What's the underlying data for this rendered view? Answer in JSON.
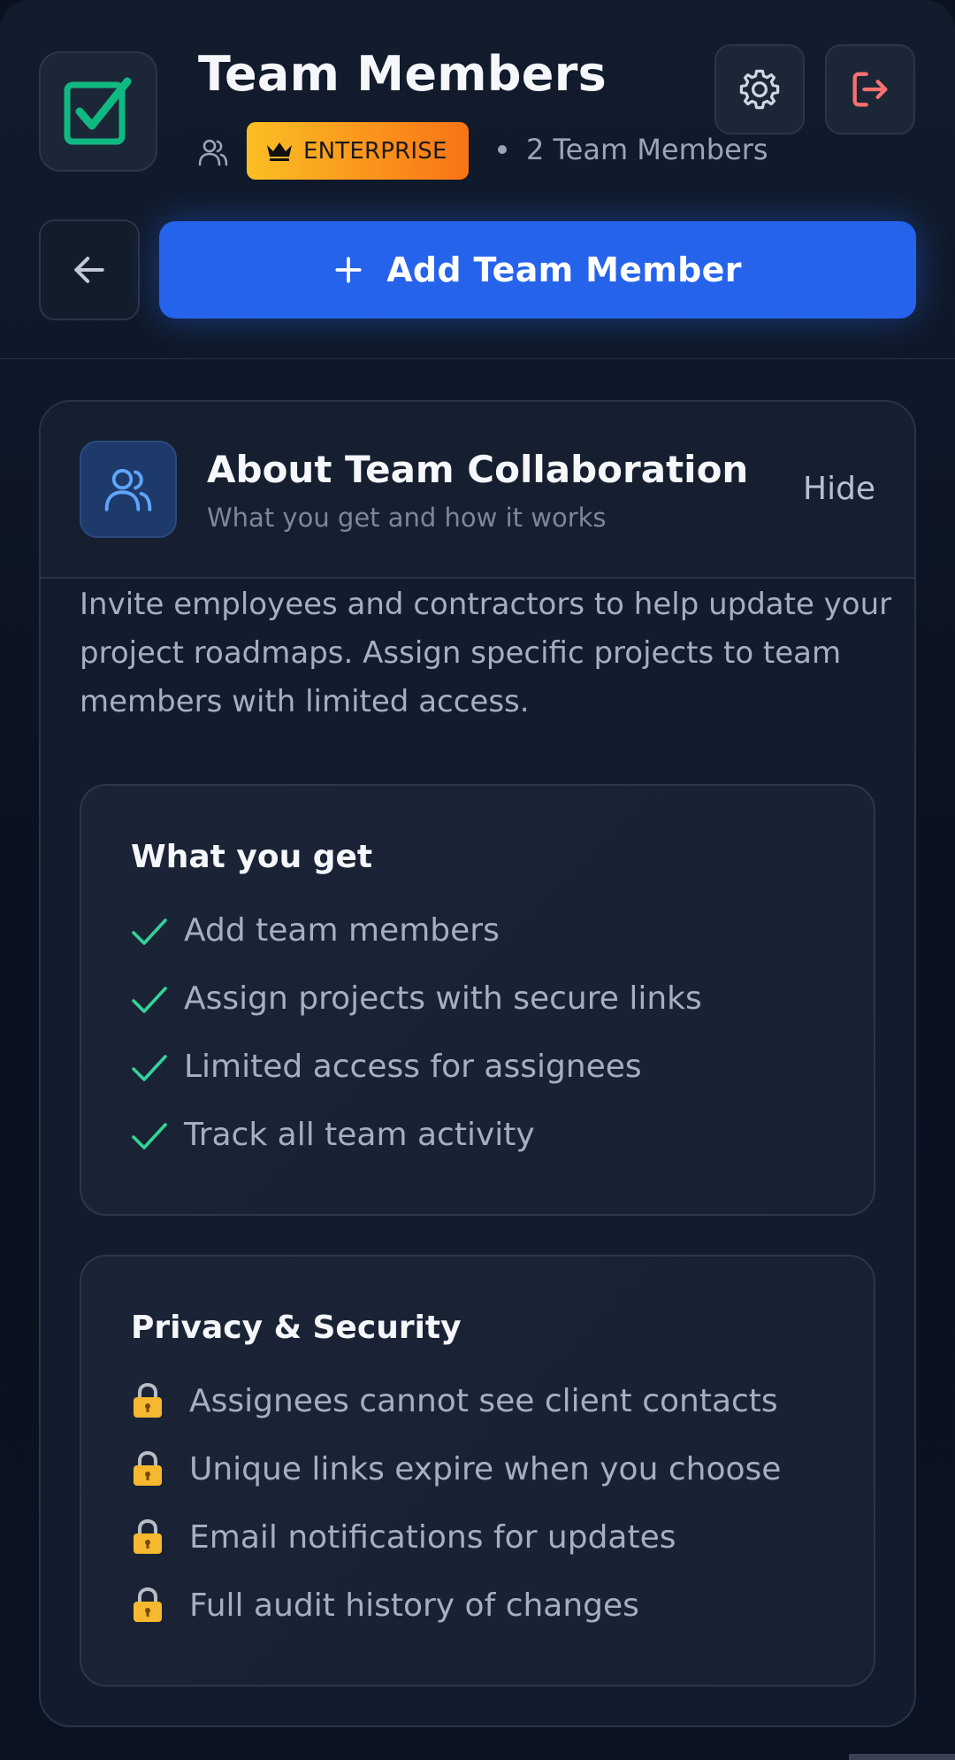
{
  "header": {
    "title": "Team Members",
    "plan_badge": "ENTERPRISE",
    "member_count": "2 Team Members",
    "add_button_label": "Add Team Member"
  },
  "about": {
    "title": "About Team Collaboration",
    "subtitle": "What you get and how it works",
    "hide_label": "Hide",
    "intro": "Invite employees and contractors to help update your project roadmaps. Assign specific projects to team members with limited access."
  },
  "what_you_get": {
    "title": "What you get",
    "items": [
      "Add team members",
      "Assign projects with secure links",
      "Limited access for assignees",
      "Track all team activity"
    ]
  },
  "privacy": {
    "title": "Privacy & Security",
    "items": [
      "Assignees cannot see client contacts",
      "Unique links expire when you choose",
      "Email notifications for updates",
      "Full audit history of changes"
    ]
  },
  "colors": {
    "accent": "#2563eb",
    "success": "#34d399",
    "danger": "#f87171",
    "badge_start": "#fbbf24",
    "badge_end": "#f97316"
  },
  "icons": {
    "logo": "checkbox-icon",
    "settings": "gear-icon",
    "logout": "logout-icon",
    "back": "arrow-left-icon",
    "add": "plus-icon",
    "team": "users-icon",
    "badge": "crown-icon",
    "feature": "check-icon",
    "privacy": "lock-icon"
  }
}
